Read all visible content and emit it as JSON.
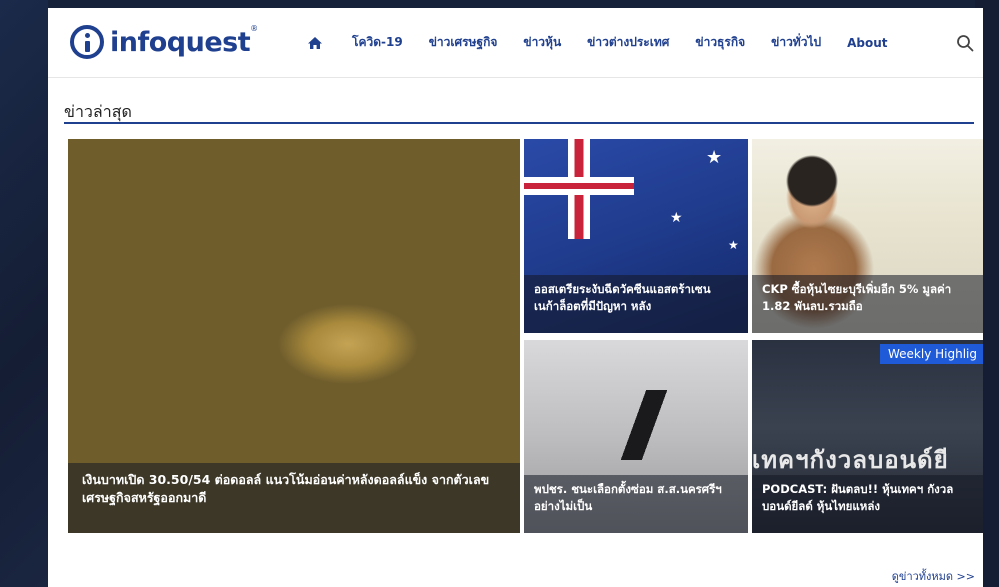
{
  "site": {
    "logo_text": "infoquest",
    "logo_registered": "®"
  },
  "nav": {
    "items": [
      {
        "label": "โควิด-19"
      },
      {
        "label": "ข่าวเศรษฐกิจ"
      },
      {
        "label": "ข่าวหุ้น"
      },
      {
        "label": "ข่าวต่างประเทศ"
      },
      {
        "label": "ข่าวธุรกิจ"
      },
      {
        "label": "ข่าวทั่วไป"
      },
      {
        "label": "About"
      }
    ]
  },
  "section": {
    "title": "ข่าวล่าสุด"
  },
  "news": {
    "main": {
      "headline": "เงินบาทเปิด 30.50/54 ต่อดอลล์ แนวโน้มอ่อนค่าหลังดอลล์แข็ง จากตัวเลขเศรษฐกิจสหรัฐออกมาดี"
    },
    "top_middle": {
      "headline": "ออสเตรียระงับฉีดวัคซีนแอสตร้าเซนเนก้าล็อตที่มีปัญหา หลัง"
    },
    "top_right": {
      "headline": "CKP ซื้อหุ้นไซยะบุรีเพิ่มอีก 5% มูลค่า 1.82 พันลบ.รวมถือ"
    },
    "bottom_middle": {
      "headline": "พปชร. ชนะเลือกตั้งซ่อม ส.ส.นครศรีฯ อย่างไม่เป็น"
    },
    "bottom_right": {
      "headline": "PODCAST: ฝันตลบ!! หุ้นเทคฯ กังวลบอนด์ยีลด์ หุ้นไทยแหล่ง",
      "badge": "Weekly Highlig",
      "overlay_text": "เทคฯกังวลบอนด์ยี"
    }
  },
  "footer": {
    "see_all": "ดูข่าวทั้งหมด >>"
  },
  "colors": {
    "brand": "#1f3f8f",
    "badge": "#1f5ad9",
    "background": "#16213a"
  }
}
